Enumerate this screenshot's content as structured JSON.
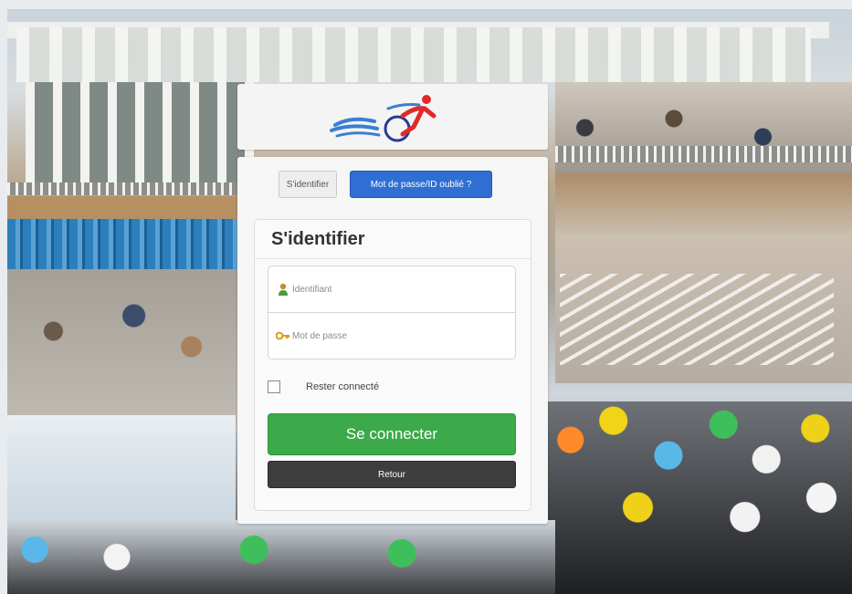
{
  "background": {
    "description_icon": "triathlon-swim-start-photo"
  },
  "logo": {
    "icon": "triathlon-logo-icon",
    "colors": {
      "waves": "#3a7fd0",
      "cyclist": "#e02a2a",
      "wheel": "#2a3a8f"
    }
  },
  "tabs": {
    "login_label": "S'identifier",
    "forgot_label": "Mot de passe/ID oublié ?"
  },
  "form": {
    "title": "S'identifier",
    "username_placeholder": "Identifiant",
    "username_icon": "user-icon",
    "password_placeholder": "Mot de passe",
    "password_icon": "key-icon",
    "remember_label": "Rester connecté",
    "remember_checked": false,
    "submit_label": "Se connecter",
    "back_label": "Retour"
  },
  "colors": {
    "primary": "#2f6fd3",
    "success": "#3ca94a",
    "dark": "#3e3e3e"
  }
}
